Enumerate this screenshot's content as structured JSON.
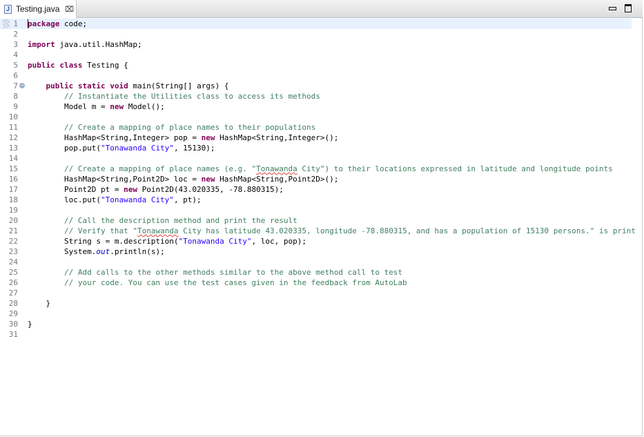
{
  "tab": {
    "label": "Testing.java",
    "icon": "java-file-icon",
    "file_icon_letter": "J"
  },
  "window_buttons": [
    "minimize",
    "maximize"
  ],
  "colors": {
    "keyword": "#7f0055",
    "comment": "#3f7f5f",
    "string": "#2a00ff",
    "field": "#0000c0",
    "current_line": "#e8f2fe"
  },
  "current_line": 1,
  "lines": [
    [
      [
        "k",
        "package"
      ],
      [
        "t",
        " code;"
      ]
    ],
    [],
    [
      [
        "k",
        "import"
      ],
      [
        "t",
        " java.util.HashMap;"
      ]
    ],
    [],
    [
      [
        "k",
        "public"
      ],
      [
        "t",
        " "
      ],
      [
        "k",
        "class"
      ],
      [
        "t",
        " Testing {"
      ]
    ],
    [],
    [
      [
        "t",
        "    "
      ],
      [
        "k",
        "public"
      ],
      [
        "t",
        " "
      ],
      [
        "k",
        "static"
      ],
      [
        "t",
        " "
      ],
      [
        "k",
        "void"
      ],
      [
        "t",
        " main(String[] args) {"
      ]
    ],
    [
      [
        "t",
        "        "
      ],
      [
        "c",
        "// Instantiate the Utilities class to access its methods"
      ]
    ],
    [
      [
        "t",
        "        Model m = "
      ],
      [
        "k",
        "new"
      ],
      [
        "t",
        " Model();"
      ]
    ],
    [],
    [
      [
        "t",
        "        "
      ],
      [
        "c",
        "// Create a mapping of place names to their populations"
      ]
    ],
    [
      [
        "t",
        "        HashMap<String,Integer> pop = "
      ],
      [
        "k",
        "new"
      ],
      [
        "t",
        " HashMap<String,Integer>();"
      ]
    ],
    [
      [
        "t",
        "        pop.put("
      ],
      [
        "s",
        "\"Tonawanda City\""
      ],
      [
        "t",
        ", 15130);"
      ]
    ],
    [],
    [
      [
        "t",
        "        "
      ],
      [
        "c",
        "// Create a mapping of place names (e.g. \""
      ],
      [
        "cs",
        "Tonawanda"
      ],
      [
        "c",
        " City\") to their locations expressed in latitude and longitude points"
      ]
    ],
    [
      [
        "t",
        "        HashMap<String,Point2D> loc = "
      ],
      [
        "k",
        "new"
      ],
      [
        "t",
        " HashMap<String,Point2D>();"
      ]
    ],
    [
      [
        "t",
        "        Point2D pt = "
      ],
      [
        "k",
        "new"
      ],
      [
        "t",
        " Point2D(43.020335, -78.880315);"
      ]
    ],
    [
      [
        "t",
        "        loc.put("
      ],
      [
        "s",
        "\"Tonawanda City\""
      ],
      [
        "t",
        ", pt);"
      ]
    ],
    [],
    [
      [
        "t",
        "        "
      ],
      [
        "c",
        "// Call the description method and print the result"
      ]
    ],
    [
      [
        "t",
        "        "
      ],
      [
        "c",
        "// Verify that \""
      ],
      [
        "cs",
        "Tonawanda"
      ],
      [
        "c",
        " City has latitude 43.020335, longitude -78.880315, and has a population of 15130 persons.\" is print"
      ]
    ],
    [
      [
        "t",
        "        String s = m.description("
      ],
      [
        "s",
        "\"Tonawanda City\""
      ],
      [
        "t",
        ", loc, pop);"
      ]
    ],
    [
      [
        "t",
        "        System."
      ],
      [
        "f",
        "out"
      ],
      [
        "t",
        ".println(s);"
      ]
    ],
    [],
    [
      [
        "t",
        "        "
      ],
      [
        "c",
        "// Add calls to the other methods similar to the above method call to test"
      ]
    ],
    [
      [
        "t",
        "        "
      ],
      [
        "c",
        "// your code. You can use the test cases given in the feedback from AutoLab"
      ]
    ],
    [],
    [
      [
        "t",
        "    }"
      ]
    ],
    [],
    [
      [
        "t",
        "}"
      ]
    ],
    []
  ]
}
